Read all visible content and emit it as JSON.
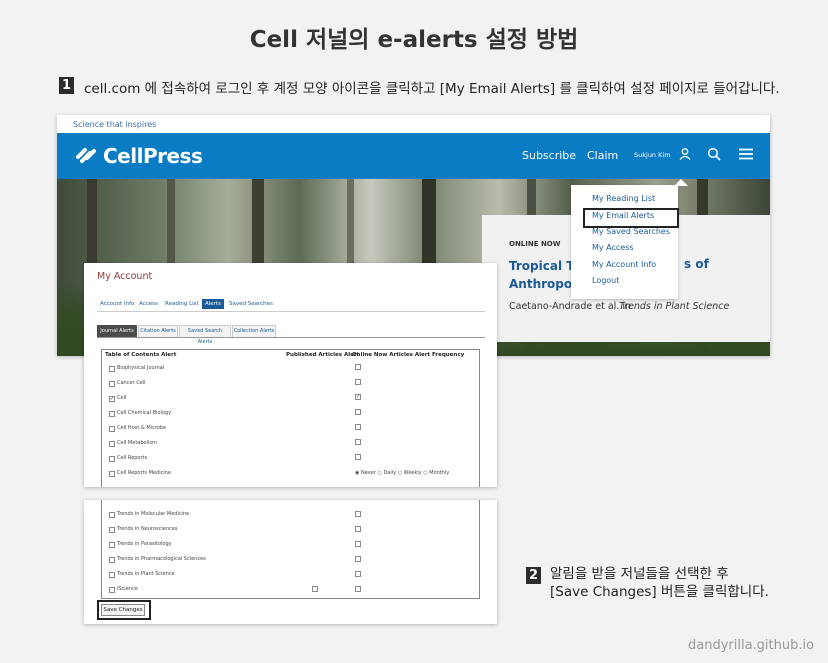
{
  "title": "Cell 저널의 e-alerts 설정 방법",
  "step1": {
    "num": "1",
    "text": "cell.com 에 접속하여 로그인 후 계정 모양 아이콘을 클릭하고 [My Email Alerts] 를 클릭하여 설정 페이지로 들어갑니다."
  },
  "step2": {
    "num": "2",
    "line1": "알림을 받을 저널들을 선택한 후",
    "line2": "[Save Changes] 버튼을 클릭합니다."
  },
  "site": {
    "tagline": "Science that inspires",
    "logo": "CellPress",
    "nav": {
      "subscribe": "Subscribe",
      "claim": "Claim",
      "user": "Sukjun Kim"
    },
    "icons": {
      "user": "user-icon",
      "search": "search-icon",
      "menu": "menu-icon"
    },
    "online": {
      "label": "ONLINE NOW",
      "title_a": "Tropical Tree",
      "title_b": "s of",
      "title_c": "Anthropogen",
      "author": "Caetano-Andrade et al. in",
      "journal": "Trends in Plant Science"
    },
    "dropdown": [
      "My Reading List",
      "My Email Alerts",
      "My Saved Searches",
      "My Access",
      "My Account Info",
      "Logout"
    ]
  },
  "account": {
    "title": "My Account",
    "tabs": [
      "Account Info",
      "Access",
      "Reading List",
      "Alerts",
      "Saved Searches"
    ],
    "active_tab": "Alerts",
    "subtabs": [
      "Journal Alerts",
      "Citation Alerts",
      "Saved Search Alerts",
      "Collection Alerts"
    ],
    "headers": {
      "toc": "Table of Contents Alert",
      "published": "Published Articles Alert",
      "online": "Online Now Articles Alert Frequency"
    },
    "rows": [
      {
        "name": "Biophysical Journal",
        "checked": false,
        "online": false
      },
      {
        "name": "Cancer Cell",
        "checked": false,
        "online": false
      },
      {
        "name": "Cell",
        "checked": true,
        "online": true
      },
      {
        "name": "Cell Chemical Biology",
        "checked": false,
        "online": false
      },
      {
        "name": "Cell Host & Microbe",
        "checked": false,
        "online": false
      },
      {
        "name": "Cell Metabolism",
        "checked": false,
        "online": false
      },
      {
        "name": "Cell Reports",
        "checked": false,
        "online": false
      },
      {
        "name": "Cell Reports Medicine",
        "checked": false,
        "freq": true
      }
    ],
    "freq_options": [
      "Never",
      "Daily",
      "Weekly",
      "Monthly"
    ],
    "rows_lower": [
      {
        "name": "Trends in Molecular Medicine",
        "pub": false
      },
      {
        "name": "Trends in Neurosciences",
        "pub": false
      },
      {
        "name": "Trends in Parasitology",
        "pub": false
      },
      {
        "name": "Trends in Pharmacological Sciences",
        "pub": false
      },
      {
        "name": "Trends in Plant Science",
        "pub": false
      },
      {
        "name": "iScience",
        "pub": true
      }
    ],
    "save": "Save Changes"
  },
  "watermark": "dandyrilla.github.io"
}
